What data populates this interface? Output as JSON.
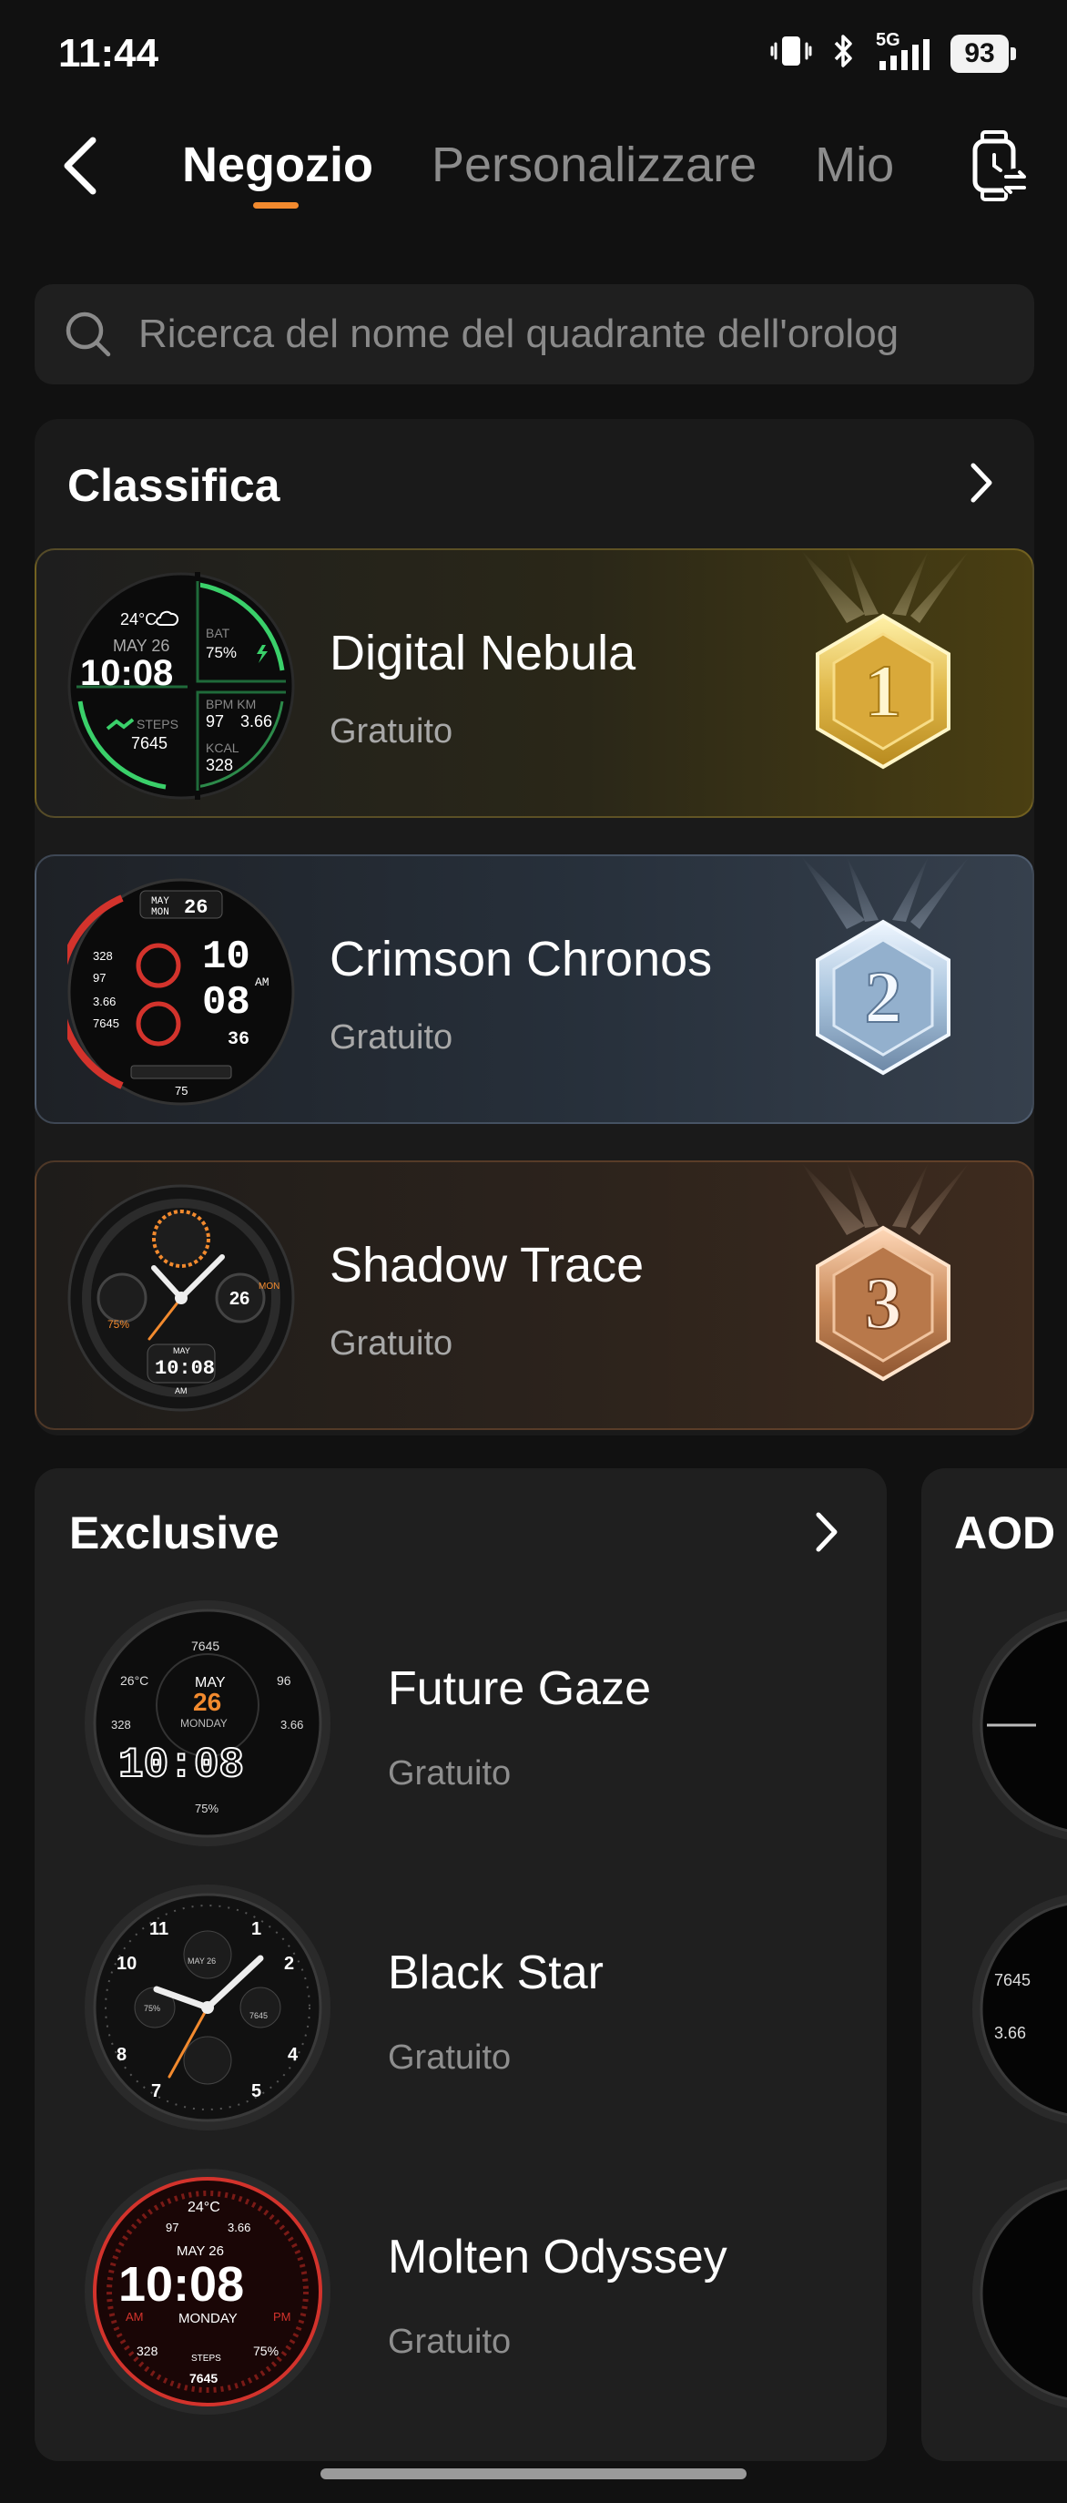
{
  "status_bar": {
    "time": "11:44",
    "network": "5G",
    "battery": "93",
    "icons": [
      "vibrate-icon",
      "bluetooth-icon",
      "signal-icon",
      "battery-icon"
    ]
  },
  "header": {
    "tabs": [
      {
        "label": "Negozio",
        "active": true
      },
      {
        "label": "Personalizzare",
        "active": false
      },
      {
        "label": "Mio",
        "active": false
      }
    ]
  },
  "search": {
    "placeholder": "Ricerca del nome del quadrante dell'orolog"
  },
  "ranking": {
    "title": "Classifica",
    "items": [
      {
        "rank": "1",
        "name": "Digital Nebula",
        "price": "Gratuito",
        "face": {
          "temp": "24°C",
          "date": "MAY 26",
          "time": "10:08",
          "bat_label": "BAT",
          "bat": "75%",
          "bpm_label": "BPM KM",
          "bpm": "97",
          "km": "3.66",
          "steps_label": "STEPS",
          "steps": "7645",
          "kcal_label": "KCAL",
          "kcal": "328"
        }
      },
      {
        "rank": "2",
        "name": "Crimson Chronos",
        "price": "Gratuito",
        "face": {
          "month": "MAY",
          "day": "MON",
          "date": "26",
          "h": "10",
          "m": "08",
          "s": "36",
          "ampm": "AM",
          "kcal": "328",
          "bpm": "97",
          "km": "3.66",
          "steps": "7645",
          "bat": "75"
        }
      },
      {
        "rank": "3",
        "name": "Shadow Trace",
        "price": "Gratuito",
        "face": {
          "date": "26",
          "day": "MON",
          "month": "MAY",
          "time": "10:08",
          "ampm": "AM",
          "bat": "75%"
        }
      }
    ]
  },
  "exclusive": {
    "title": "Exclusive",
    "items": [
      {
        "name": "Future Gaze",
        "price": "Gratuito",
        "face": {
          "steps": "7645",
          "temp": "26°C",
          "bpm": "96",
          "month": "MAY",
          "date": "26",
          "day": "MONDAY",
          "kcal": "328",
          "km": "3.66",
          "time": "10:08",
          "bat": "75%"
        }
      },
      {
        "name": "Black Star",
        "price": "Gratuito",
        "face": {
          "n11": "11",
          "n1": "1",
          "n10": "10",
          "n2": "2",
          "n8": "8",
          "n4": "4",
          "n7": "7",
          "n5": "5",
          "date": "MAY 26",
          "bat": "75%",
          "steps": "7645"
        }
      },
      {
        "name": "Molten Odyssey",
        "price": "Gratuito",
        "face": {
          "temp": "24°C",
          "bpm": "97",
          "km": "3.66",
          "date": "MAY 26",
          "time": "10:08",
          "am": "AM",
          "pm": "PM",
          "day": "MONDAY",
          "kcal": "328",
          "steps_label": "STEPS",
          "bat": "75%",
          "steps": "7645"
        }
      }
    ]
  },
  "aod": {
    "title": "AOD",
    "face2": {
      "steps": "7645",
      "km": "3.66"
    }
  },
  "colors": {
    "accent": "#f28a2e",
    "gold": "#e0b84a",
    "silver": "#a9c4dd",
    "bronze": "#c98a5a",
    "neon_green": "#3ad06a",
    "crimson": "#d3332c"
  }
}
